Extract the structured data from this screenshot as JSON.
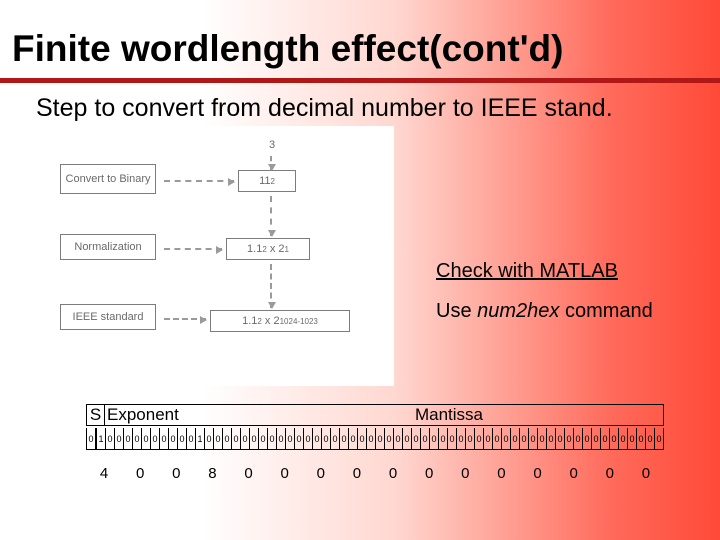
{
  "title": "Finite wordlength effect(cont'd)",
  "subtitle": "Step to convert from decimal number  to IEEE stand.",
  "diagram": {
    "left_boxes": [
      "Convert to Binary",
      "Normalization",
      "IEEE standard"
    ],
    "right_values": {
      "top": "3",
      "binary": "11",
      "binary_sub": "2",
      "norm_base": "1.1",
      "norm_sub": "2",
      "norm_exp": "1",
      "ieee_base": "1.1",
      "ieee_sub": "2",
      "ieee_exp": "1024-1023"
    }
  },
  "check_label": "Check with MATLAB",
  "use_prefix": "Use ",
  "use_cmd": "num2hex",
  "use_suffix": " command",
  "table": {
    "s_label": "S",
    "exp_label": "Exponent",
    "man_label": "Mantissa",
    "bits": [
      "0",
      "1",
      "0",
      "0",
      "0",
      "0",
      "0",
      "0",
      "0",
      "0",
      "0",
      "0",
      "1",
      "0",
      "0",
      "0",
      "0",
      "0",
      "0",
      "0",
      "0",
      "0",
      "0",
      "0",
      "0",
      "0",
      "0",
      "0",
      "0",
      "0",
      "0",
      "0",
      "0",
      "0",
      "0",
      "0",
      "0",
      "0",
      "0",
      "0",
      "0",
      "0",
      "0",
      "0",
      "0",
      "0",
      "0",
      "0",
      "0",
      "0",
      "0",
      "0",
      "0",
      "0",
      "0",
      "0",
      "0",
      "0",
      "0",
      "0",
      "0",
      "0",
      "0",
      "0"
    ],
    "hex": [
      "4",
      "0",
      "0",
      "8",
      "0",
      "0",
      "0",
      "0",
      "0",
      "0",
      "0",
      "0",
      "0",
      "0",
      "0",
      "0"
    ]
  },
  "chart_data": {
    "type": "table",
    "title": "IEEE 754 double-precision bit layout for decimal value 3",
    "fields": {
      "S_width": 1,
      "Exponent_width": 11,
      "Mantissa_width": 52
    },
    "binary": "0100000000001000000000000000000000000000000000000000000000000000",
    "hex": "4008000000000000",
    "decimal_value": 3
  }
}
